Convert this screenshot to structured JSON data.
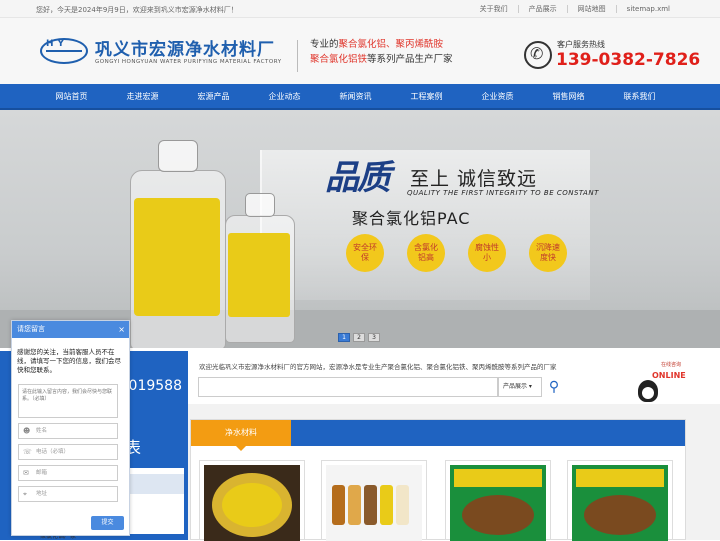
{
  "topbar": {
    "welcome": "您好，今天是2024年9月9日，欢迎来到巩义市宏源净水材料厂！",
    "links": [
      "关于我们",
      "产品展示",
      "网站地图",
      "sitemap.xml"
    ]
  },
  "header": {
    "logo_letters": "HY",
    "company_name": "巩义市宏源净水材料厂",
    "company_en": "GONGYI HONGYUAN WATER PURIFYING MATERIAL FACTORY",
    "slogan_line1_prefix": "专业的",
    "slogan_line1_red": "聚合氯化铝、聚丙烯酰胺",
    "slogan_line2_red": "聚合氯化铝铁",
    "slogan_line2_suffix": "等系列产品生产厂家",
    "hotline_label": "客户服务热线",
    "hotline": "139-0382-7826"
  },
  "nav": [
    "网站首页",
    "走进宏源",
    "宏源产品",
    "企业动态",
    "新闻资讯",
    "工程案例",
    "企业资质",
    "销售网络",
    "联系我们"
  ],
  "banner": {
    "quality_char1": "品",
    "quality_char2": "质",
    "headline": "至上 诚信致远",
    "headline_en": "QUALITY THE FIRST   INTEGRITY TO BE CONSTANT",
    "product": "聚合氯化铝PAC",
    "badges": [
      "安全环保",
      "含氯化铝高",
      "腐蚀性小",
      "沉降速度快"
    ],
    "pages": [
      "1",
      "2",
      "3"
    ]
  },
  "hotstrip": {
    "number_fragment": "019588"
  },
  "search": {
    "notice": "欢迎光临巩义市宏源净水材料厂的官方网站，宏源净水是专业生产聚合氯化铝、聚合氯化铝铁、聚丙烯酰胺等系列产品的厂家",
    "select_value": "产品展示 ▾",
    "search_icon": "search-icon"
  },
  "online": {
    "text": "在线咨询",
    "label": "ONLINE"
  },
  "left_column": {
    "heading_fragment": "表",
    "list_fragment": "聚氯化铝厂家"
  },
  "products": {
    "tab": "净水材料",
    "colors": {
      "yellow": "#e9cb18",
      "green": "#1a8f3c",
      "brown": "#7a4a1f"
    }
  },
  "chat": {
    "title": "请您留言",
    "close": "×",
    "intro": "感谢您的关注，当前客服人员不在线，请填写一下您的信息，我们会尽快和您联系。",
    "message_placeholder": "请在此输入留言内容，我们会尽快与您联系。（必填）",
    "fields": [
      "姓名",
      "电话（必填）",
      "邮箱",
      "地址"
    ],
    "submit": "提交"
  }
}
